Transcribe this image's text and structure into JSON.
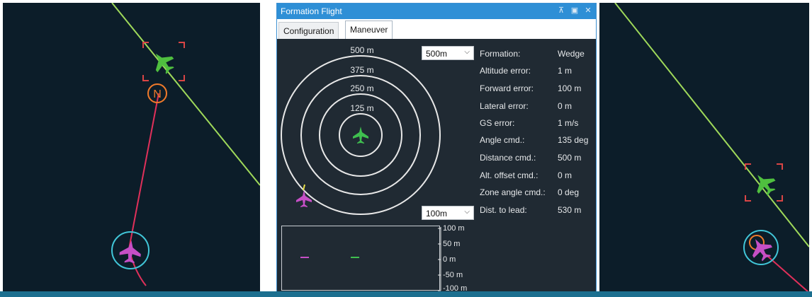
{
  "window": {
    "title": "Formation Flight",
    "pin_glyph": "⊼",
    "restore_glyph": "▣",
    "close_glyph": "✕"
  },
  "tabs": [
    {
      "label": "Configuration",
      "active": false
    },
    {
      "label": "Maneuver",
      "active": true
    }
  ],
  "radar": {
    "rings": [
      "500 m",
      "375 m",
      "250 m",
      "125 m"
    ],
    "range_select": {
      "value": "500m",
      "options": [
        "500m"
      ]
    },
    "vertical_select": {
      "value": "100m",
      "options": [
        "100m"
      ]
    },
    "leader_icon": "plane-icon",
    "follower_icon": "plane-icon",
    "leader_color": "#3fbf4f",
    "follower_color": "#c64fc6",
    "ring_color": "#e8e8e8"
  },
  "info": [
    {
      "label": "Formation:",
      "value": "Wedge"
    },
    {
      "label": "Altitude error:",
      "value": "1 m"
    },
    {
      "label": "Forward error:",
      "value": "100 m"
    },
    {
      "label": "Lateral error:",
      "value": "0 m"
    },
    {
      "label": "GS error:",
      "value": "1 m/s"
    },
    {
      "label": "Angle cmd.:",
      "value": "135 deg"
    },
    {
      "label": "Distance cmd.:",
      "value": "500 m"
    },
    {
      "label": "Alt. offset cmd.:",
      "value": "0 m"
    },
    {
      "label": "Zone angle cmd.:",
      "value": "0 deg"
    },
    {
      "label": "Dist. to lead:",
      "value": "530 m"
    }
  ],
  "vertical_scale": {
    "labels": [
      "100 m",
      "50 m",
      "0 m",
      "-50 m",
      "-100 m"
    ]
  },
  "maps": {
    "background": "#0c1d29",
    "leader_marker_letter": "N",
    "leader_path_color": "#9fd95a",
    "follower_path_color": "#e0305a",
    "target_box_color": "#d94545",
    "follower_ring_color": "#41c6d8",
    "leader_aircraft_color": "#4fbf3f",
    "follower_aircraft_color": "#c64fc6"
  }
}
